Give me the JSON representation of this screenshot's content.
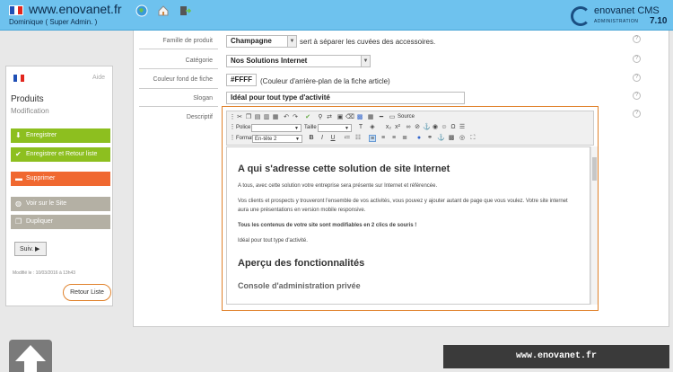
{
  "header": {
    "site": "www.enovanet.fr",
    "user": "Dominique ( Super Admin. )",
    "icons": [
      "globe-icon",
      "home-icon",
      "logout-icon"
    ],
    "brand": "enovanet CMS",
    "brand_sub": "ADMINISTRATION",
    "version": "7.10"
  },
  "form": {
    "famille": {
      "label": "Famille de produit",
      "value": "Champagne",
      "hint": "sert à séparer les cuvées des accessoires."
    },
    "categorie": {
      "label": "Catégorie",
      "value": "Nos Solutions Internet"
    },
    "couleur": {
      "label": "Couleur fond de fiche",
      "value": "#FFFF",
      "hint": "(Couleur d'arrière-plan de la fiche article)"
    },
    "slogan": {
      "label": "Slogan",
      "value": "Idéal pour tout type d'activité"
    },
    "descriptif": {
      "label": "Descriptif"
    },
    "help": "?"
  },
  "editor": {
    "source_label": "Source",
    "police_label": "Police",
    "taille_label": "Taille",
    "format_label": "Format",
    "format_value": "En-tête 2",
    "heading1": "A qui s'adresse cette solution de site Internet",
    "p1": "A tous, avec cette solution votre entreprise sera présente sur Internet et référencée.",
    "p2": "Vos clients et prospects y trouveront l'ensemble de vos activités, vous pouvez y ajouter autant de page que vous voulez. Votre site internet aura une présentations en version mobile responsive.",
    "p3": "Tous les contenus de votre site sont modifiables en 2 clics de souris !",
    "p4": "Idéal pour tout type d'activité.",
    "heading2": "Aperçu des fonctionnalités",
    "heading3": "Console d'administration privée"
  },
  "sidebar": {
    "aide": "Aide",
    "title": "Produits",
    "subtitle": "Modification",
    "btn_save": "Enregistrer",
    "btn_save_back": "Enregistrer et Retour liste",
    "btn_delete": "Supprimer",
    "btn_view": "Voir sur le Site",
    "btn_dup": "Dupliquer",
    "suiv": "Suiv. ▶",
    "modified": "Modifié le : 10/03/2016 à 13h43",
    "retour": "Retour Liste"
  },
  "footer": {
    "url": "www.enovanet.fr"
  },
  "colors": {
    "header": "#6ec2ee",
    "green": "#8dbf1f",
    "orange": "#f06830",
    "grey": "#b4b0a4",
    "accent": "#e0822c"
  }
}
